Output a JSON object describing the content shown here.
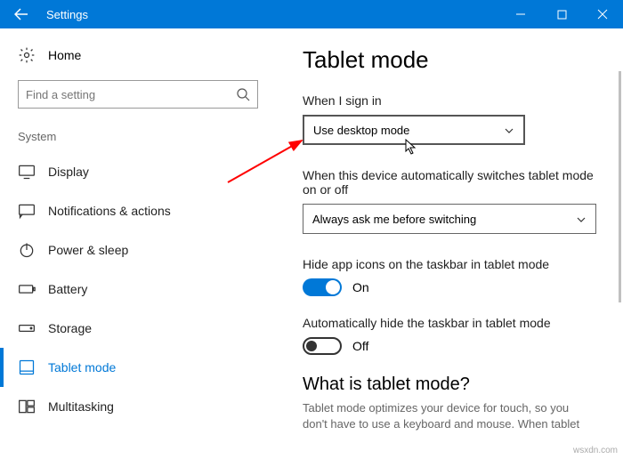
{
  "titlebar": {
    "title": "Settings"
  },
  "sidebar": {
    "home": "Home",
    "search_placeholder": "Find a setting",
    "group": "System",
    "items": [
      {
        "label": "Display"
      },
      {
        "label": "Notifications & actions"
      },
      {
        "label": "Power & sleep"
      },
      {
        "label": "Battery"
      },
      {
        "label": "Storage"
      },
      {
        "label": "Tablet mode"
      },
      {
        "label": "Multitasking"
      }
    ]
  },
  "main": {
    "title": "Tablet mode",
    "signin_label": "When I sign in",
    "signin_value": "Use desktop mode",
    "switch_label": "When this device automatically switches tablet mode on or off",
    "switch_value": "Always ask me before switching",
    "hide_icons_label": "Hide app icons on the taskbar in tablet mode",
    "hide_icons_state": "On",
    "auto_hide_label": "Automatically hide the taskbar in tablet mode",
    "auto_hide_state": "Off",
    "what_heading": "What is tablet mode?",
    "what_desc": "Tablet mode optimizes your device for touch, so you don't have to use a keyboard and mouse. When tablet"
  },
  "watermark": "wsxdn.com"
}
